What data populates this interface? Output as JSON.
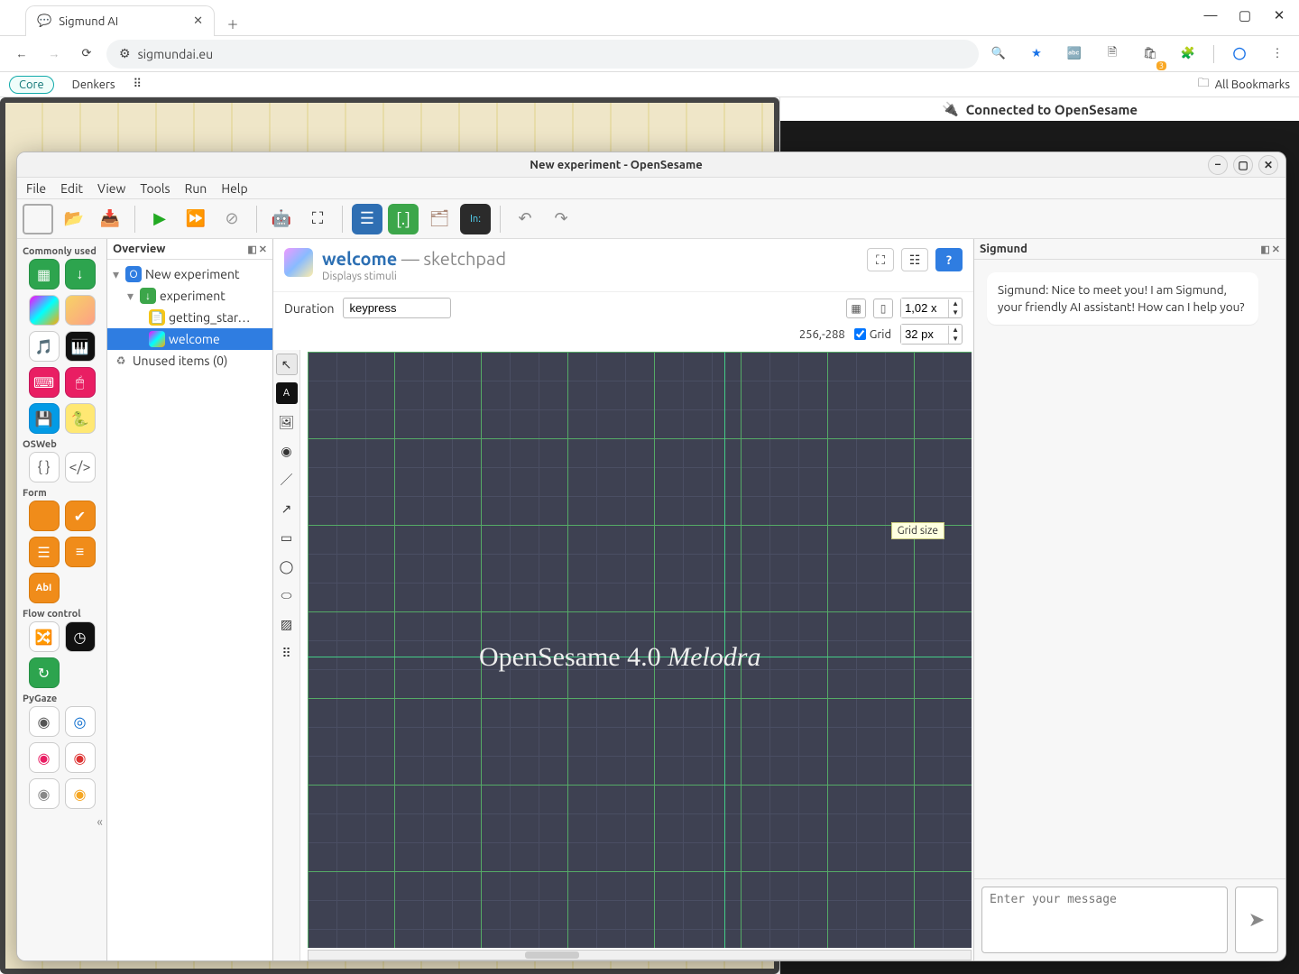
{
  "browser": {
    "tabs": [
      {
        "title": "Sigmund AI"
      }
    ],
    "address": "sigmundai.eu",
    "window_controls": {
      "min": "—",
      "max": "▢",
      "close": "✕"
    },
    "toolbar_icons": [
      "magnify",
      "star",
      "translate",
      "page",
      "ext",
      "puzzle",
      "divider",
      "circle-o",
      "kebab"
    ],
    "bookmarks": {
      "core": "Core",
      "denkers": "Denkers",
      "all": "All Bookmarks"
    }
  },
  "page": {
    "conn_status": "Connected to OpenSesame"
  },
  "os": {
    "window_title": "New experiment - OpenSesame",
    "menu": [
      "File",
      "Edit",
      "View",
      "Tools",
      "Run",
      "Help"
    ],
    "panels": {
      "overview": "Overview",
      "sigmund": "Sigmund"
    },
    "tree": {
      "root": "New experiment",
      "seq": "experiment",
      "rows": [
        {
          "label": "getting_star…",
          "icon": "📄",
          "depth": 2
        },
        {
          "label": "welcome",
          "icon": "grad",
          "depth": 2,
          "selected": true
        }
      ],
      "unused": "Unused items (0)"
    },
    "palette": {
      "commonly": "Commonly used",
      "osweb": "OSWeb",
      "form": "Form",
      "flow": "Flow control",
      "pygaze": "PyGaze"
    },
    "editor": {
      "name": "welcome",
      "sep": " — ",
      "type": "sketchpad",
      "sub": "Displays stimuli",
      "duration_label": "Duration",
      "duration_value": "keypress",
      "zoom": "1,02 x",
      "coords": "256,-288",
      "grid_label": "Grid",
      "grid_checked": true,
      "grid_px": "32 px",
      "tooltip": "Grid size",
      "canvas_text_a": "OpenSesame 4.0 ",
      "canvas_text_b": "Melodra"
    },
    "sigmund": {
      "bubble": "Sigmund: Nice to meet you! I am Sigmund, your friendly AI assistant! How can I help you?",
      "placeholder": "Enter your message"
    }
  }
}
